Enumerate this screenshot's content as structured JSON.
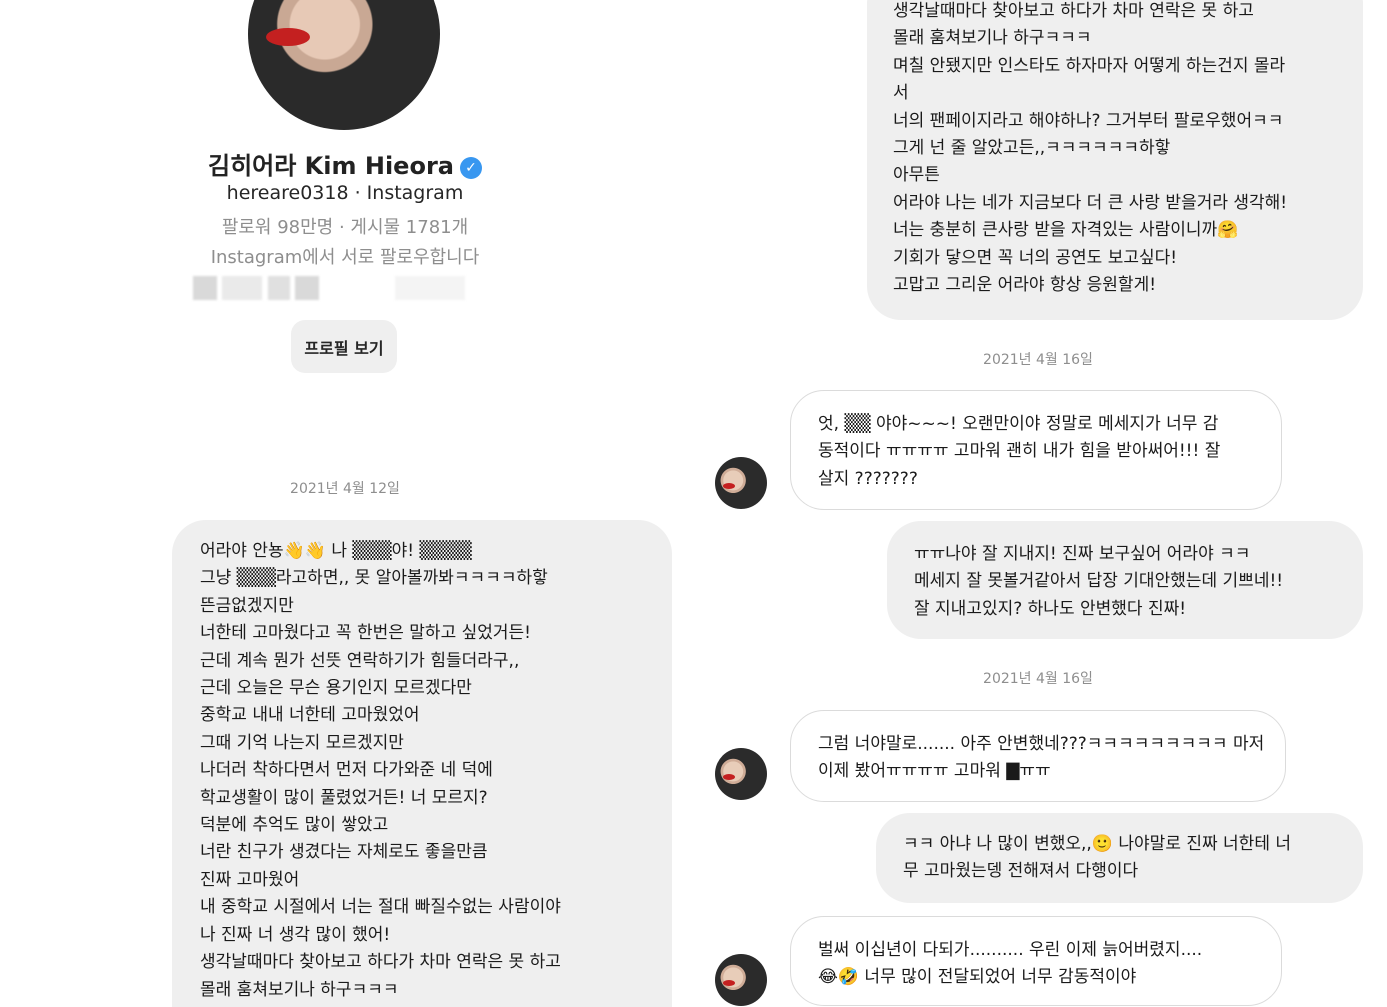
{
  "profile": {
    "name": "김히어라 Kim Hieora",
    "verified_icon": "verified-badge-icon",
    "handle_line": "hereare0318 · Instagram",
    "stats": "팔로워 98만명 · 게시물 1781개",
    "mutual": "Instagram에서 서로 팔로우합니다",
    "view_profile_label": "프로필 보기"
  },
  "left": {
    "date": "2021년 4월 12일",
    "message_lines": [
      "어라야 안뇽👋👋 나 ▒▒▒야! ▒▒▒▒",
      "그냥 ▒▒▒라고하면,, 못 알아볼까봐ㅋㅋㅋㅋ하핳",
      "뜬금없겠지만",
      "너한테 고마웠다고 꼭 한번은 말하고 싶었거든!",
      "근데 계속 뭔가 선뜻 연락하기가 힘들더라구,,",
      "근데 오늘은 무슨 용기인지 모르겠다만",
      "중학교 내내 너한테 고마웠었어",
      "그때 기억 나는지 모르겠지만",
      "나더러 착하다면서 먼저 다가와준 네 덕에",
      "학교생활이 많이 풀렸었거든! 너 모르지?",
      "덕분에 추억도 많이 쌓았고",
      "너란 친구가 생겼다는 자체로도 좋을만큼",
      "진짜 고마웠어",
      "내 중학교 시절에서 너는 절대 빠질수없는 사람이야",
      "나 진짜 너 생각 많이 했어!",
      "생각날때마다 찾아보고 하다가 차마 연락은 못 하고",
      "몰래 훔쳐보기나 하구ㅋㅋㅋ"
    ]
  },
  "right": {
    "first_bubble_lines": [
      "생각날때마다 찾아보고 하다가 차마 연락은 못 하고",
      "몰래 훔쳐보기나 하구ㅋㅋㅋ",
      "며칠 안됐지만 인스타도 하자마자 어떻게 하는건지 몰라",
      "서",
      "너의 팬페이지라고 해야하나? 그거부터 팔로우했어ㅋㅋ",
      "그게 넌 줄 알았고든,,ㅋㅋㅋㅋㅋㅋ하핳",
      "아무튼",
      "어라야 나는 네가 지금보다 더 큰 사랑 받을거라 생각해!",
      "너는 충분히 큰사랑 받을 자격있는 사람이니까🤗",
      "기회가 닿으면 꼭 너의 공연도 보고싶다!",
      "고맙고 그리운 어라야 항상 응원할게!"
    ],
    "date1": "2021년 4월 16일",
    "reply1_lines": [
      "엇, ▒▒ 야야~~~! 오랜만이야 정말로 메세지가 너무 감",
      "동적이다 ㅠㅠㅠㅠ 고마워 괜히 내가 힘을 받아써어!!! 잘",
      "살지 ???????"
    ],
    "msg2_lines": [
      "ㅠㅠ나야 잘 지내지! 진짜 보구싶어 어라야 ㅋㅋ",
      "메세지 잘 못볼거같아서 답장 기대안했는데 기쁘네!!",
      "잘 지내고있지? 하나도 안변했다 진짜!"
    ],
    "date2": "2021년 4월 16일",
    "reply2_lines": [
      "그럼 너야말로....... 아주 안변했네???ㅋㅋㅋㅋㅋㅋㅋㅋㅋ 마저",
      "이제 봤어ㅠㅠㅠㅠ 고마워 ▇ㅠㅠ"
    ],
    "msg3_lines": [
      "ㅋㅋ 아냐 나 많이 변했오,,🙂 나야말로 진짜 너한테 너",
      "무 고마웠는뎅 전해져서 다행이다"
    ],
    "reply3_lines": [
      "벌써 이십년이 다되가.......... 우린 이제 늙어버렸지....",
      "😂🤣 너무 많이 전달되었어 너무 감동적이야"
    ]
  },
  "icons": {
    "avatar": "avatar-icon"
  }
}
